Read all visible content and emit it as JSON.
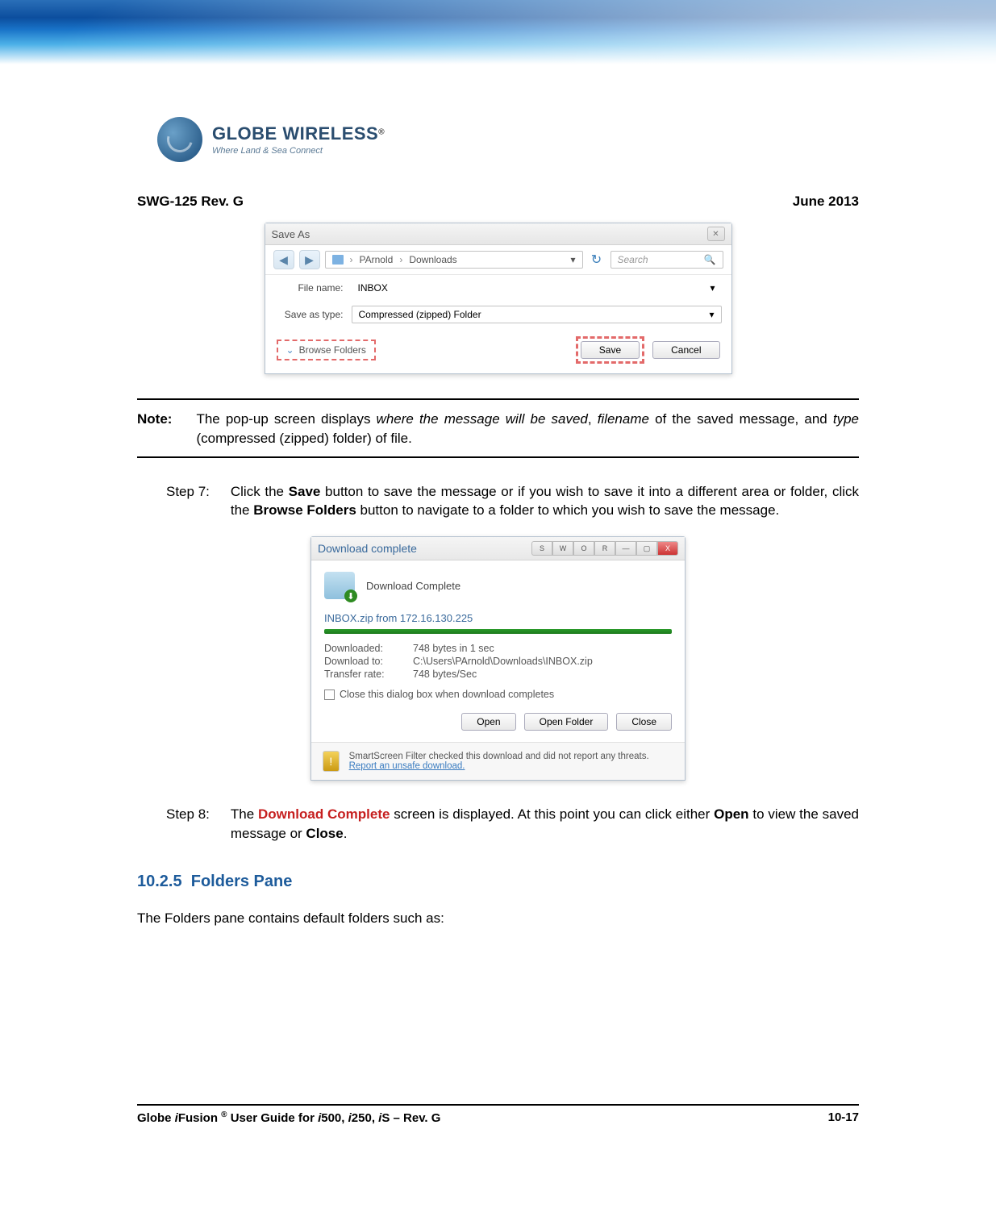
{
  "header": {
    "doc_id": "SWG-125 Rev. G",
    "date": "June 2013"
  },
  "logo": {
    "brand": "GLOBE WIRELESS",
    "reg": "®",
    "tagline": "Where Land & Sea Connect"
  },
  "save_as": {
    "title": "Save As",
    "crumb1": "PArnold",
    "crumb2": "Downloads",
    "search_placeholder": "Search",
    "filename_label": "File name:",
    "filename_value": "INBOX",
    "type_label": "Save as type:",
    "type_value": "Compressed (zipped) Folder",
    "browse": "Browse Folders",
    "save": "Save",
    "cancel": "Cancel"
  },
  "note": {
    "label": "Note:",
    "t1": "The pop-up screen displays ",
    "i1": "where the message will be saved",
    "t2": ", ",
    "i2": "filename",
    "t3": " of the saved message, and ",
    "i3": "type",
    "t4": " (compressed (zipped) folder) of file."
  },
  "step7": {
    "label": "Step  7:",
    "t1": "Click the ",
    "b1": "Save",
    "t2": " button to save the message or if you wish to save it into a different area or folder, click the ",
    "b2": "Browse Folders",
    "t3": " button to navigate to a folder to which you wish to save the message."
  },
  "download": {
    "title": "Download complete",
    "head": "Download Complete",
    "line": "INBOX.zip from 172.16.130.225",
    "rows": {
      "r1l": "Downloaded:",
      "r1v": "748 bytes in 1 sec",
      "r2l": "Download to:",
      "r2v": "C:\\Users\\PArnold\\Downloads\\INBOX.zip",
      "r3l": "Transfer rate:",
      "r3v": "748 bytes/Sec"
    },
    "chk": "Close this dialog box when download completes",
    "open": "Open",
    "open_folder": "Open Folder",
    "close": "Close",
    "foot_t": "SmartScreen Filter checked this download and did not report any threats. ",
    "foot_link": "Report an unsafe download.",
    "wb": {
      "s": "S",
      "w": "W",
      "o": "O",
      "r": "R",
      "min": "—",
      "max": "▢",
      "x": "X"
    }
  },
  "step8": {
    "label": "Step  8:",
    "t1": "The ",
    "r1": "Download Complete",
    "t2": " screen is displayed. At this point you can click either ",
    "b1": "Open",
    "t3": " to view the saved message or ",
    "b2": "Close",
    "t4": "."
  },
  "section": {
    "num": "10.2.5",
    "title": "Folders Pane"
  },
  "para1": "The Folders pane contains default folders such as:",
  "footer": {
    "left_a": "Globe ",
    "left_b": "i",
    "left_c": "Fusion ",
    "left_d": "®",
    "left_e": " User Guide for ",
    "left_f": "i",
    "left_g": "500, ",
    "left_h": "i",
    "left_i": "250, ",
    "left_j": "i",
    "left_k": "S – Rev. G",
    "page": "10-17"
  }
}
